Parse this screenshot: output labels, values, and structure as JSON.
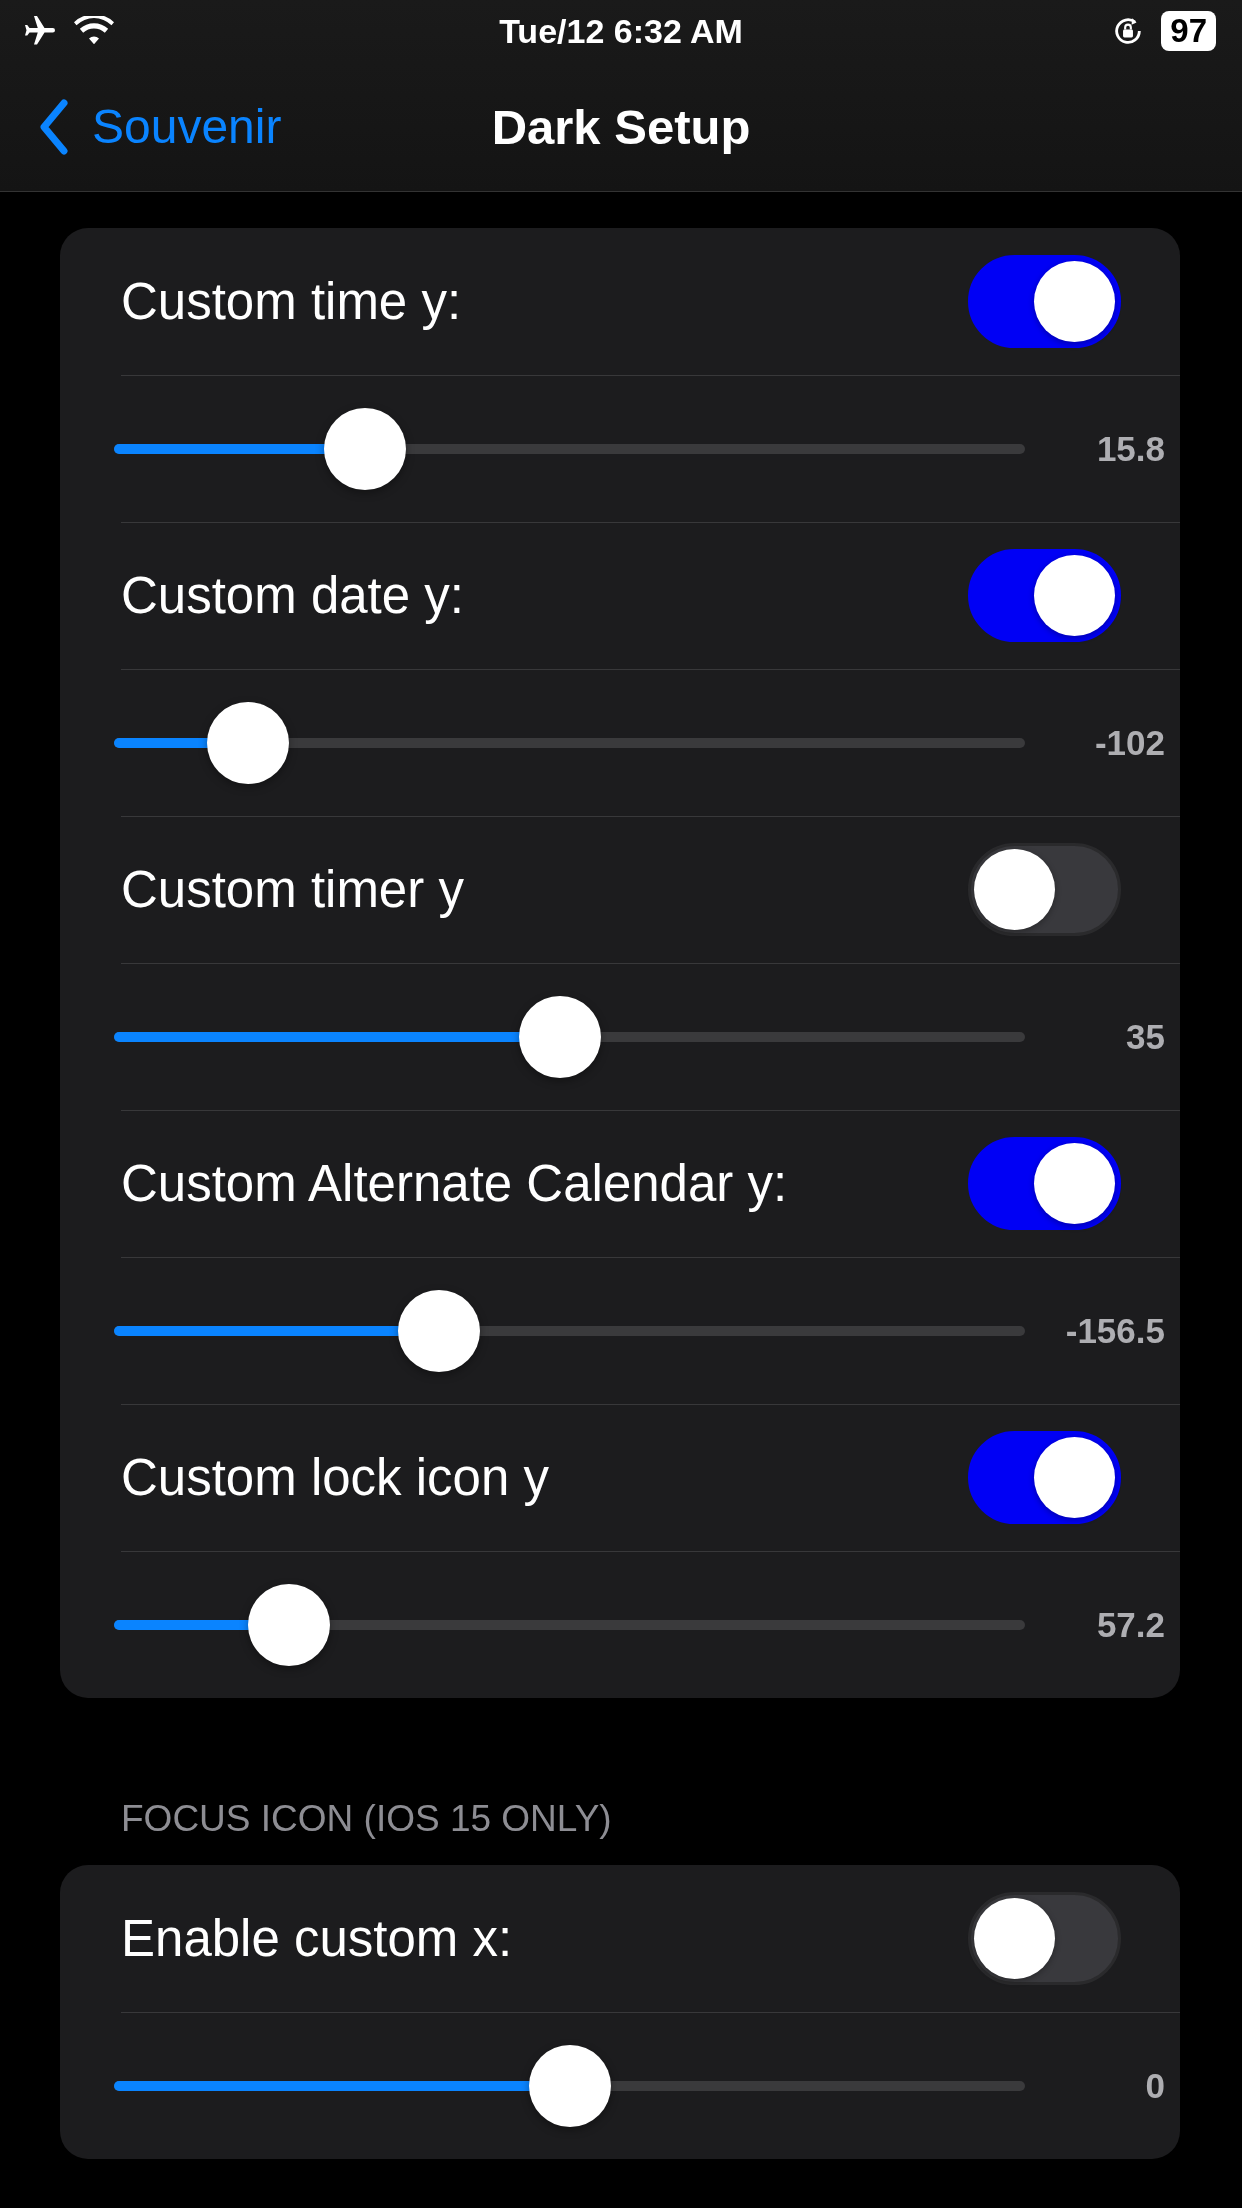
{
  "status_bar": {
    "time": "Tue/12 6:32 AM",
    "battery": "97"
  },
  "nav": {
    "back": "Souvenir",
    "title": "Dark Setup"
  },
  "sections": [
    {
      "items": [
        {
          "kind": "toggle",
          "label": "Custom time y:",
          "on": true
        },
        {
          "kind": "slider",
          "level": 0.275,
          "reading": "15.8"
        },
        {
          "kind": "toggle",
          "label": "Custom date y:",
          "on": true
        },
        {
          "kind": "slider",
          "level": 0.147,
          "reading": "-102"
        },
        {
          "kind": "toggle",
          "label": "Custom timer y",
          "on": false
        },
        {
          "kind": "slider",
          "level": 0.49,
          "reading": "35"
        },
        {
          "kind": "toggle",
          "label": "Custom Alternate Calendar y:",
          "on": true
        },
        {
          "kind": "slider",
          "level": 0.357,
          "reading": "-156.5"
        },
        {
          "kind": "toggle",
          "label": "Custom lock icon y",
          "on": true
        },
        {
          "kind": "slider",
          "level": 0.192,
          "reading": "57.2"
        }
      ]
    },
    {
      "header": "FOCUS ICON (IOS 15 ONLY)",
      "items": [
        {
          "kind": "toggle",
          "label": "Enable custom x:",
          "on": false
        },
        {
          "kind": "slider",
          "level": 0.5,
          "reading": "0"
        }
      ]
    }
  ]
}
